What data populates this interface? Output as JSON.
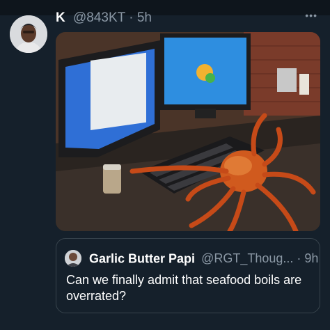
{
  "tweet": {
    "author_name": "K",
    "handle_time": "@843KT · 5h",
    "more_icon": "more-horizontal-icon",
    "image_alt": "Photo of a large red king crab sprawled across a computer keyboard on a desk with two monitors"
  },
  "quoted_tweet": {
    "author_name": "Garlic Butter Papi",
    "handle_time": "@RGT_Thoug... · 9h",
    "text": "Can we finally admit that seafood boils are overrated?"
  },
  "colors": {
    "background": "#15202b",
    "secondary_text": "#8b98a5",
    "border": "#38444d"
  }
}
